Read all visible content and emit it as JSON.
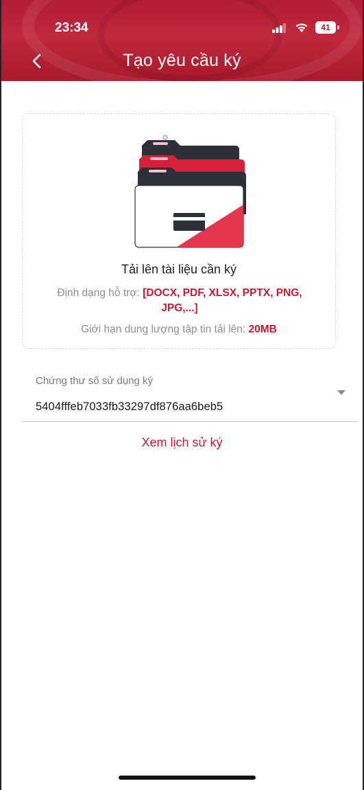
{
  "status_bar": {
    "time": "23:34",
    "battery_level": "41",
    "signal_icon": "signal-bars-icon",
    "wifi_icon": "wifi-icon",
    "battery_icon": "battery-icon"
  },
  "header": {
    "title": "Tạo yêu cầu ký",
    "back_icon": "chevron-left-icon",
    "background_color": "#b11d33"
  },
  "upload": {
    "icon": "folder-document-icon",
    "title": "Tải lên tài liệu cần ký",
    "formats_label": "Định dạng hỗ trợ:",
    "formats_value": "[DOCX, PDF, XLSX, PPTX, PNG, JPG,...]",
    "limit_label": "Giới hạn dung lượng tập tin tải lên:",
    "limit_value": "20MB"
  },
  "certificate": {
    "label": "Chứng thư số sử dụng ký",
    "selected_value": "5404fffeb7033fb33297df876aa6beb5",
    "dropdown_icon": "chevron-down-icon"
  },
  "history_link": {
    "label": "Xem lịch sử ký"
  },
  "colors": {
    "accent": "#d0172f",
    "muted_text": "#8e8e8e"
  }
}
